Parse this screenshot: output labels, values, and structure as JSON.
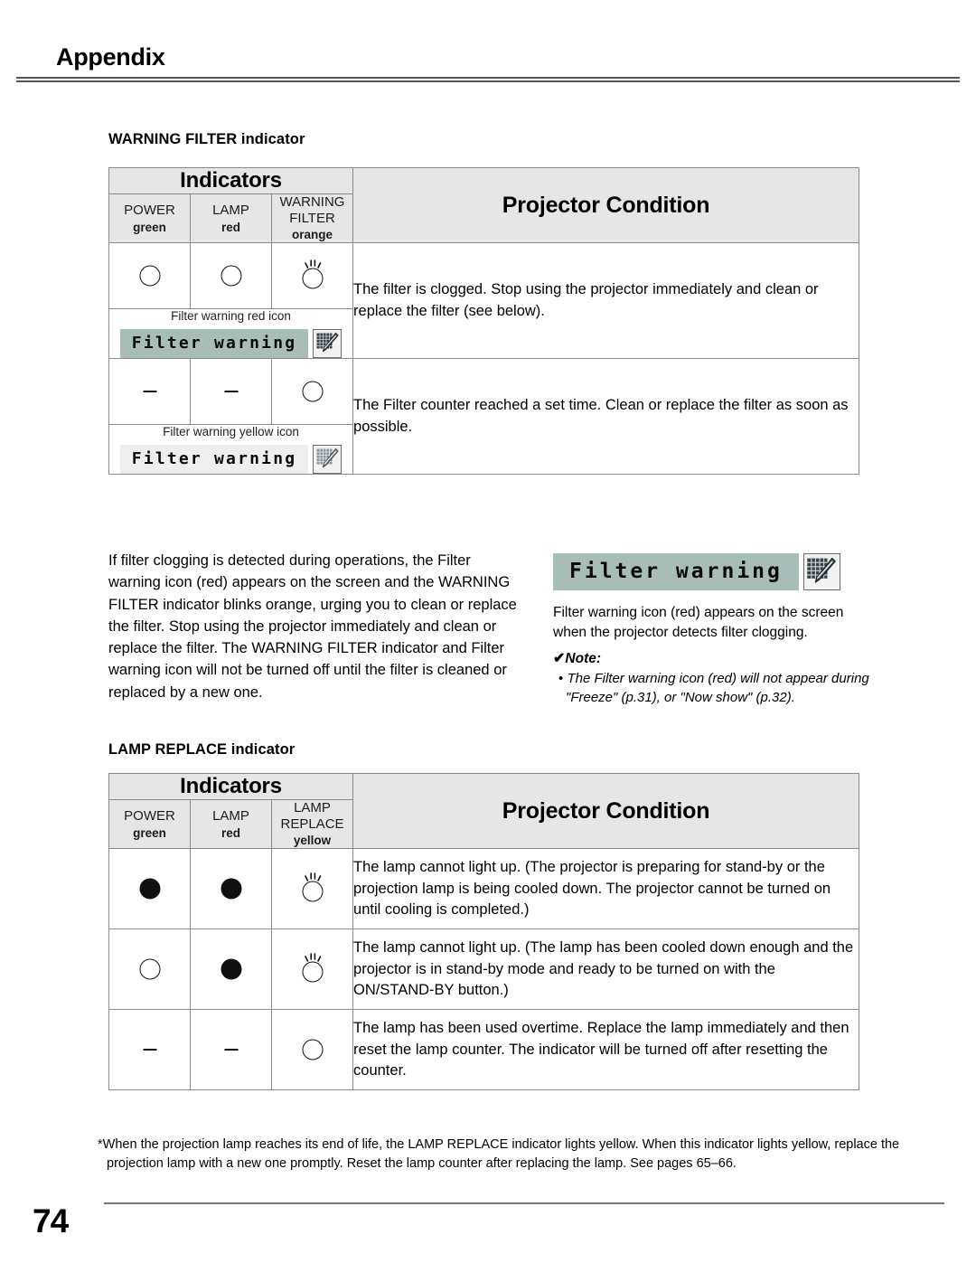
{
  "page": {
    "header_title": "Appendix",
    "page_number": "74"
  },
  "sections": [
    {
      "label": "WARNING FILTER indicator",
      "table": {
        "indicators_header": "Indicators",
        "condition_header": "Projector Condition",
        "columns": [
          {
            "name": "POWER",
            "color": "green"
          },
          {
            "name": "LAMP",
            "color": "red"
          },
          {
            "name": "WARNING FILTER",
            "color": "orange"
          }
        ],
        "rows": [
          {
            "states": [
              "off",
              "off",
              "blink"
            ],
            "condition": "The filter is clogged. Stop using the projector immediately and clean or replace the filter (see below).",
            "osd": {
              "caption": "Filter warning red icon",
              "label": "Filter warning",
              "style": "red"
            }
          },
          {
            "states": [
              "dash",
              "dash",
              "off"
            ],
            "condition": "The Filter counter reached a set time. Clean or replace the filter as soon as possible.",
            "osd": {
              "caption": "Filter warning yellow icon",
              "label": "Filter warning",
              "style": "yellow"
            }
          }
        ]
      }
    },
    {
      "label": "LAMP REPLACE indicator",
      "table": {
        "indicators_header": "Indicators",
        "condition_header": "Projector Condition",
        "columns": [
          {
            "name": "POWER",
            "color": "green"
          },
          {
            "name": "LAMP",
            "color": "red"
          },
          {
            "name": "LAMP REPLACE",
            "color": "yellow"
          }
        ],
        "rows": [
          {
            "states": [
              "on",
              "on",
              "blink"
            ],
            "condition": "The lamp cannot light up. (The projector is preparing for stand-by or the projection lamp is being cooled down. The projector cannot be turned on until cooling is completed.)"
          },
          {
            "states": [
              "off",
              "on",
              "blink"
            ],
            "condition": "The lamp cannot light up. (The lamp has been cooled down enough and the projector is in stand-by mode and ready to be turned on with the ON/STAND-BY button.)"
          },
          {
            "states": [
              "dash",
              "dash",
              "off"
            ],
            "condition": "The lamp has been used overtime. Replace the lamp immediately and then reset the lamp counter. The indicator will be turned off after resetting the counter."
          }
        ]
      }
    }
  ],
  "body": {
    "filter_paragraph": "If filter clogging is detected during operations, the Filter warning icon (red) appears on the screen and the WARNING FILTER indicator blinks orange, urging you to clean or replace the filter. Stop using the projector immediately and clean or replace the filter. The WARNING FILTER indicator and Filter warning icon will not be turned off until the filter is cleaned or replaced by a new one.",
    "osd_banner_label": "Filter warning",
    "osd_caption": "Filter warning icon (red) appears on the screen when the projector detects filter clogging.",
    "note_check": "✔",
    "note_title": "Note:",
    "note_bullet": "•",
    "note_text": "The Filter warning icon (red) will not appear during \"Freeze\" (p.31), or \"Now show\" (p.32)."
  },
  "footnote": {
    "marker": "*",
    "text": "When the projection lamp reaches its end of life, the LAMP REPLACE indicator lights yellow. When this indicator lights yellow, replace the projection lamp with a new one promptly. Reset the lamp counter after replacing the lamp. See pages 65–66."
  }
}
